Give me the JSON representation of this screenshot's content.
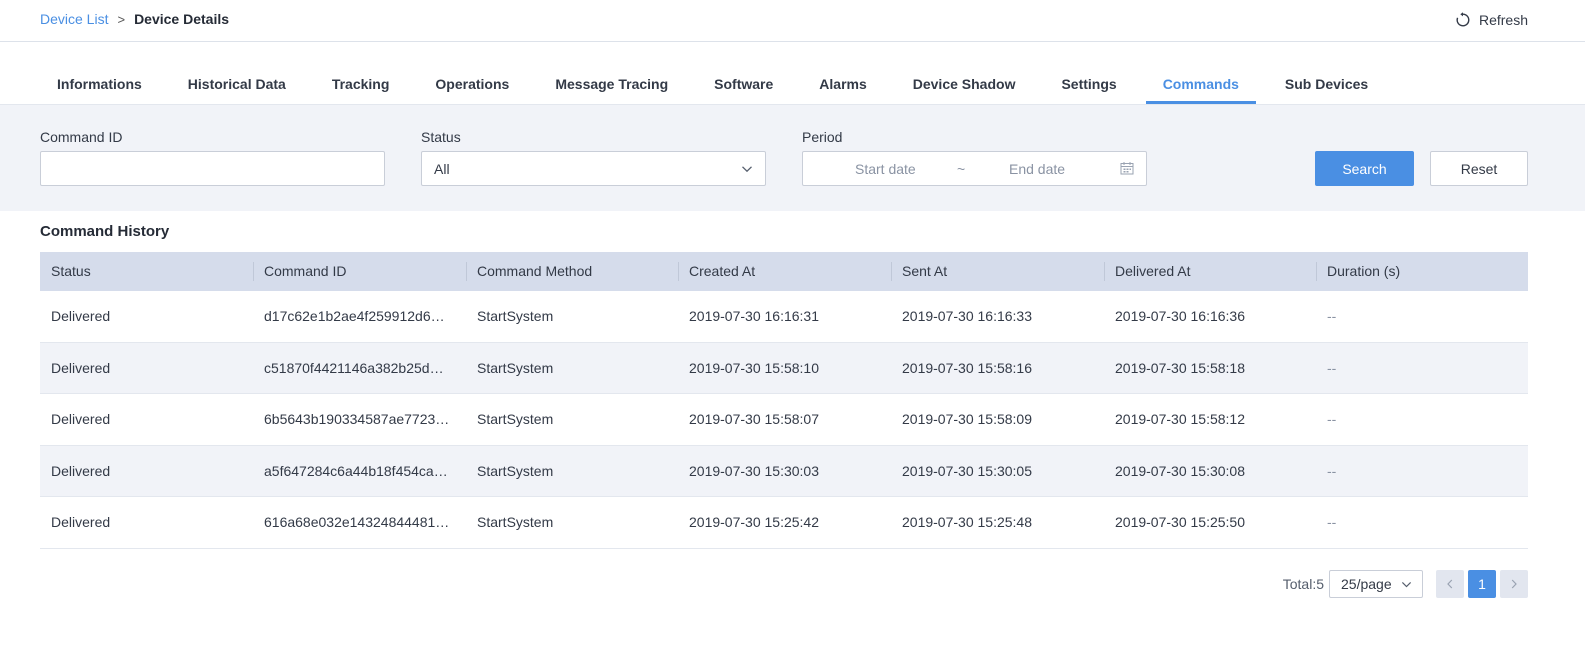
{
  "breadcrumb": {
    "link": "Device List",
    "separator": ">",
    "current": "Device Details"
  },
  "header": {
    "refresh_label": "Refresh",
    "refresh_icon": "refresh-icon"
  },
  "tabs": [
    {
      "label": "Informations",
      "active": false
    },
    {
      "label": "Historical Data",
      "active": false
    },
    {
      "label": "Tracking",
      "active": false
    },
    {
      "label": "Operations",
      "active": false
    },
    {
      "label": "Message Tracing",
      "active": false
    },
    {
      "label": "Software",
      "active": false
    },
    {
      "label": "Alarms",
      "active": false
    },
    {
      "label": "Device Shadow",
      "active": false
    },
    {
      "label": "Settings",
      "active": false
    },
    {
      "label": "Commands",
      "active": true
    },
    {
      "label": "Sub Devices",
      "active": false
    }
  ],
  "filters": {
    "command_id": {
      "label": "Command ID",
      "value": ""
    },
    "status": {
      "label": "Status",
      "value": "All"
    },
    "period": {
      "label": "Period",
      "start_placeholder": "Start date",
      "separator": "~",
      "end_placeholder": "End date"
    },
    "search_label": "Search",
    "reset_label": "Reset"
  },
  "table": {
    "title": "Command History",
    "columns": [
      "Status",
      "Command ID",
      "Command Method",
      "Created At",
      "Sent At",
      "Delivered At",
      "Duration (s)"
    ],
    "rows": [
      [
        "Delivered",
        "d17c62e1b2ae4f259912d6…",
        "StartSystem",
        "2019-07-30 16:16:31",
        "2019-07-30 16:16:33",
        "2019-07-30 16:16:36",
        "--"
      ],
      [
        "Delivered",
        "c51870f4421146a382b25d…",
        "StartSystem",
        "2019-07-30 15:58:10",
        "2019-07-30 15:58:16",
        "2019-07-30 15:58:18",
        "--"
      ],
      [
        "Delivered",
        "6b5643b190334587ae7723…",
        "StartSystem",
        "2019-07-30 15:58:07",
        "2019-07-30 15:58:09",
        "2019-07-30 15:58:12",
        "--"
      ],
      [
        "Delivered",
        "a5f647284c6a44b18f454ca…",
        "StartSystem",
        "2019-07-30 15:30:03",
        "2019-07-30 15:30:05",
        "2019-07-30 15:30:08",
        "--"
      ],
      [
        "Delivered",
        "616a68e032e14324844481…",
        "StartSystem",
        "2019-07-30 15:25:42",
        "2019-07-30 15:25:48",
        "2019-07-30 15:25:50",
        "--"
      ]
    ]
  },
  "pagination": {
    "total_label": "Total:5",
    "page_size": "25/page",
    "current_page": "1"
  },
  "colors": {
    "accent": "#4a8fe3",
    "panel_bg": "#f1f3f8",
    "header_bg": "#d5dceb"
  }
}
